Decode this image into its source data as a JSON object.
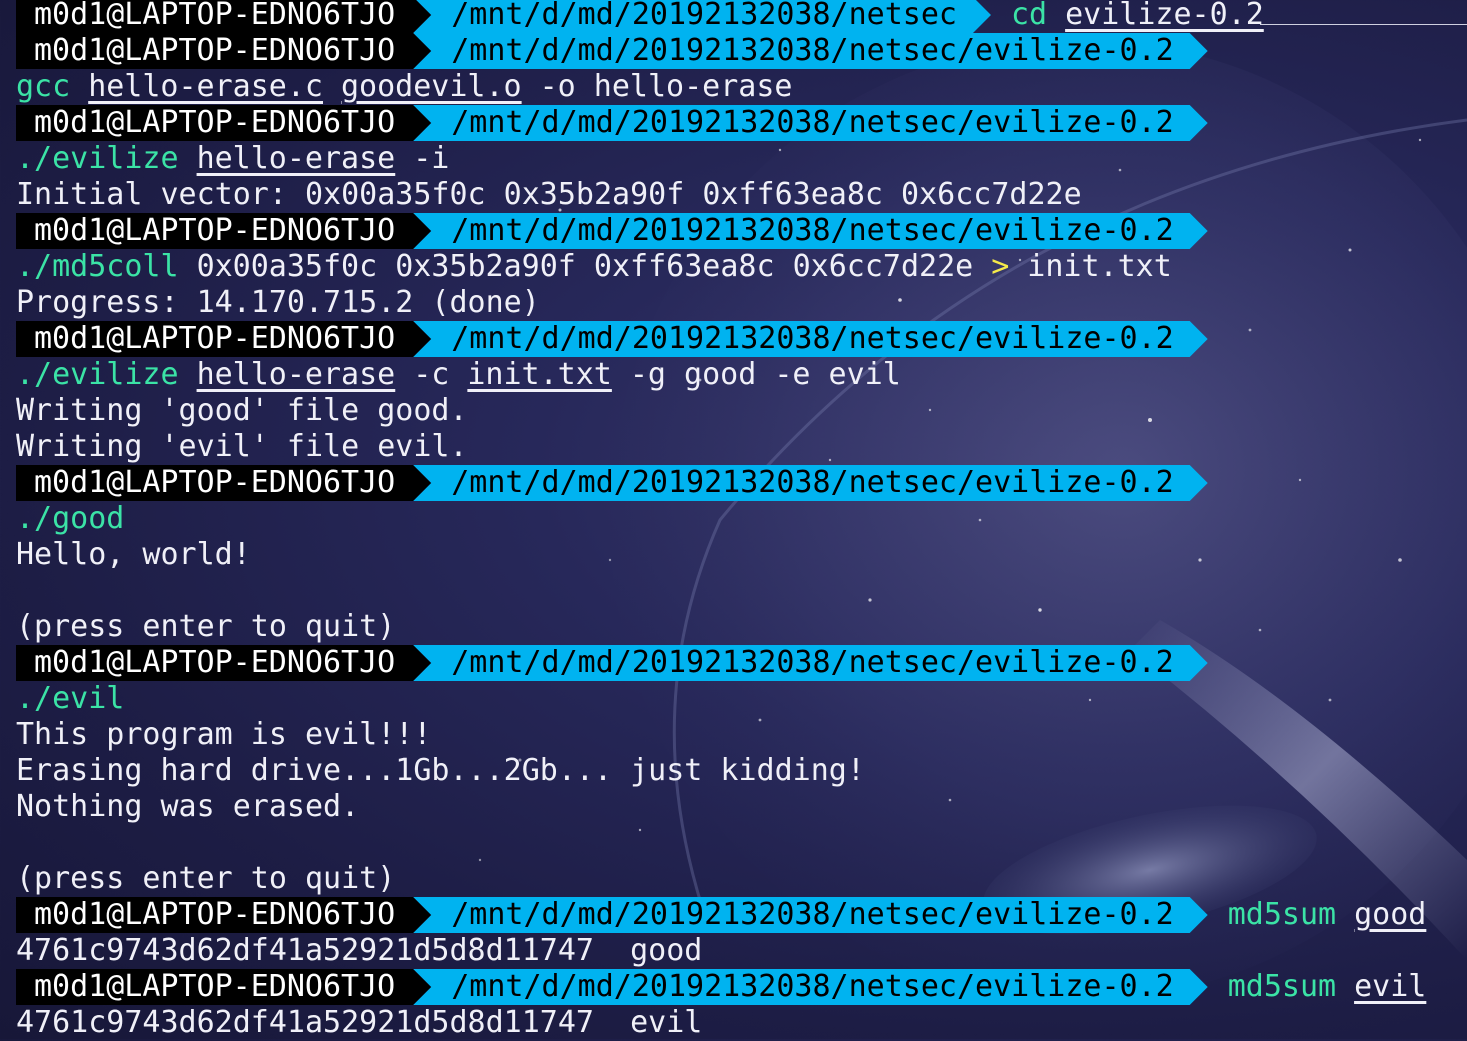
{
  "prompt": {
    "user": "m0d1@LAPTOP-EDNO6TJO",
    "path_netsec": "/mnt/d/md/20192132038/netsec",
    "path_evilize": "/mnt/d/md/20192132038/netsec/evilize-0.2"
  },
  "lines": {
    "l0_cmd": "cd",
    "l0_arg": "evilize-0.2",
    "l2_cmd": "gcc",
    "l2_arg1": "hello-erase.c",
    "l2_arg2": "goodevil.o",
    "l2_rest": "-o hello-erase",
    "l4_cmd": "./evilize",
    "l4_arg": "hello-erase",
    "l4_opt": "-i",
    "l5_out": "Initial vector: 0x00a35f0c 0x35b2a90f 0xff63ea8c 0x6cc7d22e",
    "l7_cmd": "./md5coll",
    "l7_args": "0x00a35f0c 0x35b2a90f 0xff63ea8c 0x6cc7d22e",
    "l7_redir": ">",
    "l7_file": "init.txt",
    "l8_out": "Progress: 14.170.715.2 (done)",
    "l10_cmd": "./evilize",
    "l10_arg1": "hello-erase",
    "l10_opt1": "-c",
    "l10_arg2": "init.txt",
    "l10_rest": "-g good -e evil",
    "l11_out": "Writing 'good' file good.",
    "l12_out": "Writing 'evil' file evil.",
    "l14_cmd": "./good",
    "l15_out": "Hello, world!",
    "l17_out": "(press enter to quit)",
    "l19_cmd": "./evil",
    "l20_out": "This program is evil!!!",
    "l21_out": "Erasing hard drive...1Gb...2Gb... just kidding!",
    "l22_out": "Nothing was erased.",
    "l24_out": "(press enter to quit)",
    "l25_cmd": "md5sum",
    "l25_arg": "good",
    "l26_out": "4761c9743d62df41a52921d5d8d11747  good",
    "l27_cmd": "md5sum",
    "l27_arg": "evil",
    "l28_out": "4761c9743d62df41a52921d5d8d11747  evil"
  },
  "colors": {
    "prompt_user_bg": "#000000",
    "prompt_path_bg": "#00b3f0",
    "command": "#3be3a6",
    "redirect": "#f4e94a",
    "background": "#1d1d45"
  }
}
